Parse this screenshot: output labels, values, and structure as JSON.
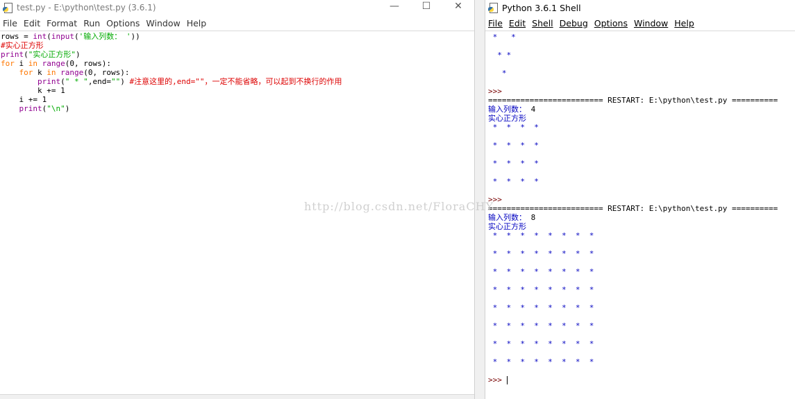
{
  "editor": {
    "title": "test.py - E:\\python\\test.py (3.6.1)",
    "window_buttons": [
      "—",
      "☐",
      "✕"
    ],
    "menu": [
      "File",
      "Edit",
      "Format",
      "Run",
      "Options",
      "Window",
      "Help"
    ],
    "code": {
      "l1_a": "rows = ",
      "l1_int": "int",
      "l1_b": "(",
      "l1_input": "input",
      "l1_c": "(",
      "l1_str": "'输入列数： '",
      "l1_d": "))",
      "l2": "#实心正方形",
      "l3_print": "print",
      "l3_a": "(",
      "l3_str": "\"实心正方形\"",
      "l3_b": ")",
      "l4_for": "for",
      "l4_a": " i ",
      "l4_in": "in",
      "l4_b": " ",
      "l4_range": "range",
      "l4_c": "(0, rows):",
      "l5_indent": "    ",
      "l5_for": "for",
      "l5_a": " k ",
      "l5_in": "in",
      "l5_b": " ",
      "l5_range": "range",
      "l5_c": "(0, rows):",
      "l6_indent": "        ",
      "l6_print": "print",
      "l6_a": "(",
      "l6_str1": "\" * \"",
      "l6_b": ",end=",
      "l6_str2": "\"\"",
      "l6_c": ") ",
      "l6_cm": "#注意这里的,end=\"\"，一定不能省略，可以起到不换行的作用",
      "l7": "        k += 1",
      "l8": "    i += 1",
      "l9_indent": "    ",
      "l9_print": "print",
      "l9_a": "(",
      "l9_str": "\"\\n\"",
      "l9_b": ")"
    }
  },
  "shell": {
    "title": "Python 3.6.1 Shell",
    "menu": [
      "File",
      "Edit",
      "Shell",
      "Debug",
      "Options",
      "Window",
      "Help"
    ],
    "top_stars": [
      " *   *",
      "",
      "  * *",
      "",
      "   *"
    ],
    "prompt": ">>>",
    "restart_line": "========================= RESTART: E:\\python\\test.py ==========",
    "run1": {
      "input_prompt": "输入列数： ",
      "input_value": "4",
      "heading": "实心正方形",
      "rows": [
        " *  *  *  *",
        "",
        " *  *  *  *",
        "",
        " *  *  *  *",
        "",
        " *  *  *  *"
      ]
    },
    "run2": {
      "input_prompt": "输入列数： ",
      "input_value": "8",
      "heading": "实心正方形",
      "rows": [
        " *  *  *  *  *  *  *  *",
        "",
        " *  *  *  *  *  *  *  *",
        "",
        " *  *  *  *  *  *  *  *",
        "",
        " *  *  *  *  *  *  *  *",
        "",
        " *  *  *  *  *  *  *  *",
        "",
        " *  *  *  *  *  *  *  *",
        "",
        " *  *  *  *  *  *  *  *",
        "",
        " *  *  *  *  *  *  *  *"
      ]
    }
  },
  "watermark": "http://blog.csdn.net/FloraCHY"
}
